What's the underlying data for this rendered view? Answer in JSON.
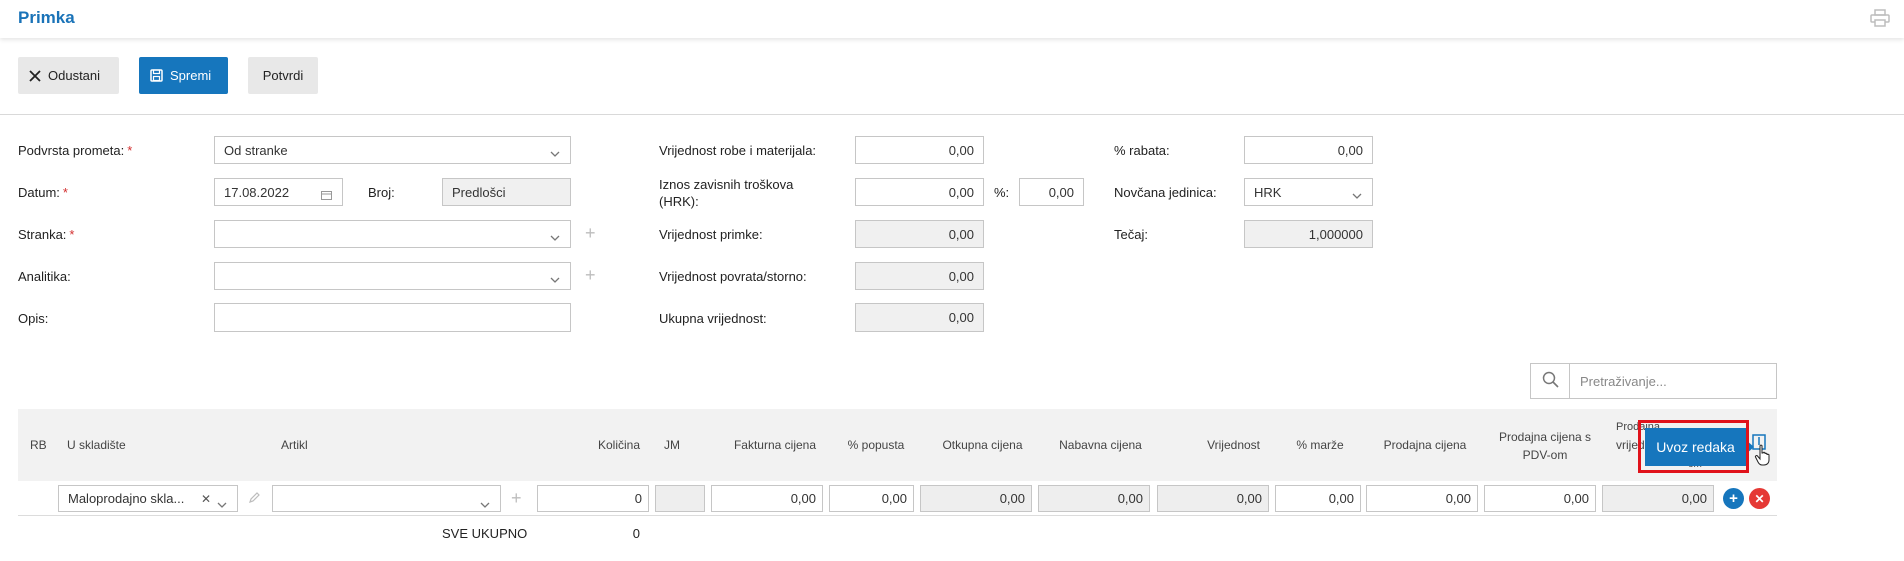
{
  "header": {
    "title": "Primka",
    "print_icon": "printer-icon"
  },
  "toolbar": {
    "cancel_label": "Odustani",
    "save_label": "Spremi",
    "confirm_label": "Potvrdi",
    "cancel_icon": "close-icon",
    "save_icon": "floppy-disk-icon"
  },
  "form": {
    "subtype": {
      "label": "Podvrsta prometa:",
      "required": "*",
      "value": "Od stranke"
    },
    "date": {
      "label": "Datum:",
      "required": "*",
      "value": "17.08.2022"
    },
    "number": {
      "label": "Broj:",
      "value": "Predlošci"
    },
    "party": {
      "label": "Stranka:",
      "required": "*",
      "value": ""
    },
    "analytics": {
      "label": "Analitika:",
      "value": ""
    },
    "description": {
      "label": "Opis:",
      "value": ""
    },
    "goods_value": {
      "label": "Vrijednost robe i materijala:",
      "value": "0,00"
    },
    "dependent_costs": {
      "label_line1": "Iznos zavisnih troškova",
      "label_line2": "(HRK):",
      "value": "0,00",
      "percent_label": "%:",
      "percent_value": "0,00"
    },
    "receipt_value": {
      "label": "Vrijednost primke:",
      "value": "0,00"
    },
    "return_value": {
      "label": "Vrijednost povrata/storno:",
      "value": "0,00"
    },
    "total_value": {
      "label": "Ukupna vrijednost:",
      "value": "0,00"
    },
    "discount": {
      "label": "% rabata:",
      "value": "0,00"
    },
    "currency": {
      "label": "Novčana jedinica:",
      "value": "HRK"
    },
    "rate": {
      "label": "Tečaj:",
      "value": "1,000000"
    }
  },
  "search": {
    "placeholder": "Pretraživanje..."
  },
  "table": {
    "columns": {
      "rb": "RB",
      "warehouse": "U skladište",
      "item": "Artikl",
      "quantity": "Količina",
      "unit": "JM",
      "invoice_price": "Fakturna cijena",
      "discount_pct": "% popusta",
      "purchase_price": "Otkupna cijena",
      "cost_price": "Nabavna cijena",
      "value": "Vrijednost",
      "margin_pct": "% marže",
      "sale_price": "Prodajna cijena",
      "sale_price_vat_line1": "Prodajna cijena s",
      "sale_price_vat_line2": "PDV-om",
      "last_col_line1": "Prodajna",
      "last_col_line2": "vrijed",
      "last_col_line3": "om"
    },
    "row": {
      "warehouse": "Maloprodajno skla...",
      "item": "",
      "quantity": "0",
      "unit": "",
      "invoice_price": "0,00",
      "discount_pct": "0,00",
      "purchase_price": "0,00",
      "cost_price": "0,00",
      "value": "0,00",
      "margin_pct": "0,00",
      "sale_price": "0,00",
      "sale_price_vat": "0,00",
      "last_value": "0,00"
    },
    "footer": {
      "total_label": "SVE UKUPNO",
      "total_quantity": "0"
    }
  },
  "tooltip": {
    "text": "Uvoz redaka"
  },
  "colors": {
    "accent": "#1676bd",
    "highlight": "#e0121b",
    "add": "#1676bd",
    "delete": "#e53935"
  }
}
